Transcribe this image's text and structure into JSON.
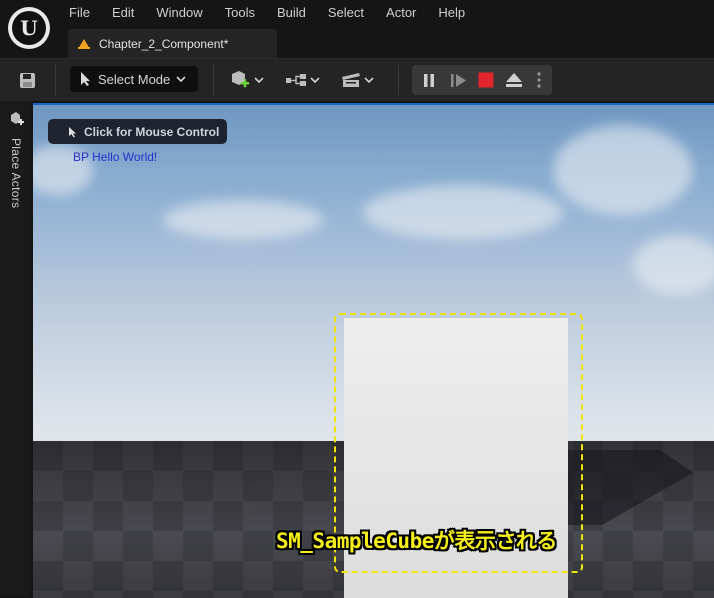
{
  "menu": {
    "items": [
      "File",
      "Edit",
      "Window",
      "Tools",
      "Build",
      "Select",
      "Actor",
      "Help"
    ]
  },
  "tab": {
    "title": "Chapter_2_Component*"
  },
  "toolbar": {
    "mode_label": "Select Mode",
    "icons": [
      "save-icon",
      "add-actor-icon",
      "blueprint-icon",
      "cinematics-icon",
      "pause-icon",
      "skip-frame-icon",
      "stop-icon",
      "eject-icon",
      "more-options-icon"
    ]
  },
  "sidebar": {
    "label": "Place Actors"
  },
  "viewport": {
    "mouse_control_label": "Click for Mouse Control",
    "debug_message": "BP Hello World!",
    "annotation": "SM_SampleCubeが表示される",
    "colors": {
      "annotation": "#f5ee1a",
      "highlight_border": "#f2e600",
      "stop": "#e2252d",
      "debug_text": "#2731c8"
    }
  }
}
